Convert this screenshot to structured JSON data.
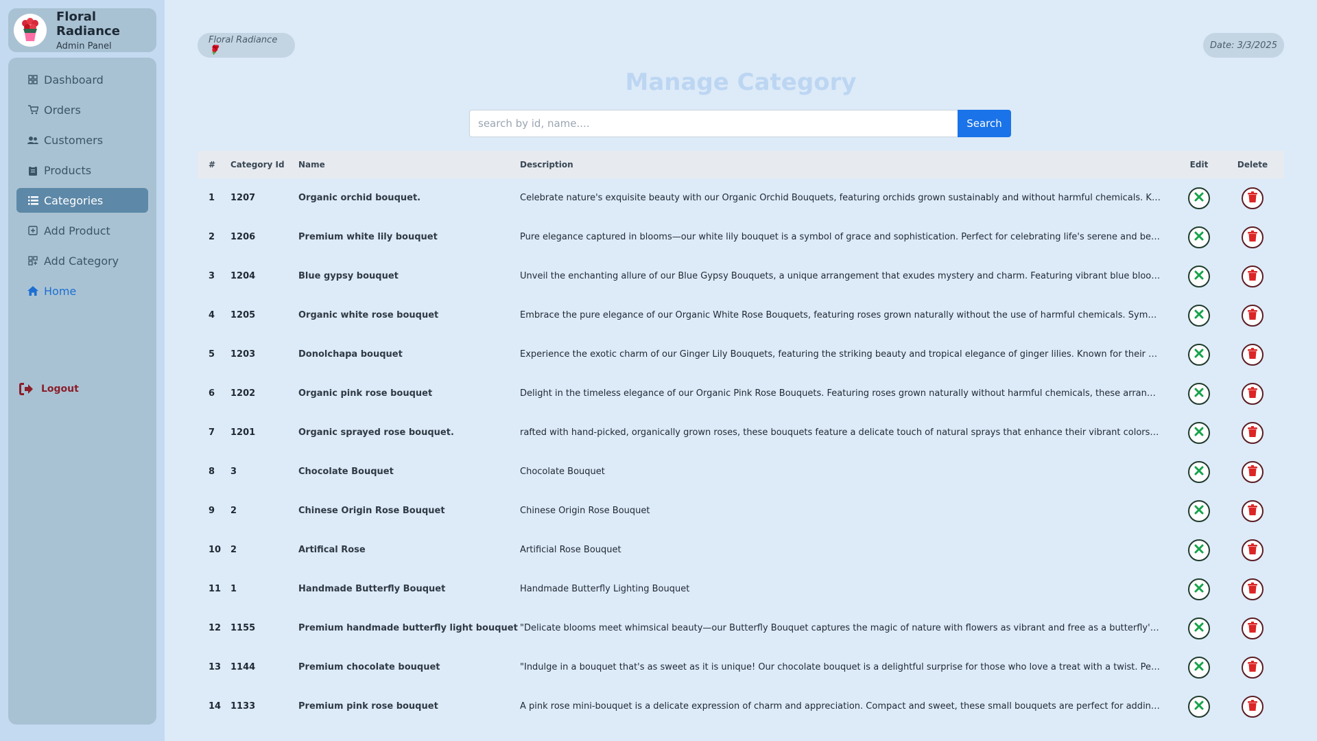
{
  "brand": {
    "name": "Floral Radiance",
    "subtitle": "Admin Panel"
  },
  "nav": {
    "items": [
      {
        "label": "Dashboard",
        "icon": "grid-icon"
      },
      {
        "label": "Orders",
        "icon": "cart-icon"
      },
      {
        "label": "Customers",
        "icon": "users-icon"
      },
      {
        "label": "Products",
        "icon": "clipboard-icon"
      },
      {
        "label": "Categories",
        "icon": "list-icon",
        "active": true
      },
      {
        "label": "Add Product",
        "icon": "plus-square-icon"
      },
      {
        "label": "Add Category",
        "icon": "grid-plus-icon"
      },
      {
        "label": "Home",
        "icon": "home-icon"
      }
    ],
    "logout_label": "Logout"
  },
  "header": {
    "brand_pill": "Floral Radiance 🌹",
    "date_pill": "Date: 3/3/2025",
    "title": "Manage Category"
  },
  "search": {
    "placeholder": "search by id, name....",
    "value": "",
    "button_label": "Search"
  },
  "table": {
    "headers": {
      "num": "#",
      "category_id": "Category Id",
      "name": "Name",
      "description": "Description",
      "edit": "Edit",
      "delete": "Delete"
    },
    "rows": [
      {
        "num": "1",
        "id": "1207",
        "name": "Organic orchid bouquet.",
        "description": "Celebrate nature's exquisite beauty with our Organic Orchid Bouquets, featuring orchids grown sustainably and without harmful chemicals. Known for ..."
      },
      {
        "num": "2",
        "id": "1206",
        "name": "Premium white lily bouquet",
        "description": "Pure elegance captured in blooms—our white lily bouquet is a symbol of grace and sophistication. Perfect for celebrating life's serene and beautifu..."
      },
      {
        "num": "3",
        "id": "1204",
        "name": "Blue gypsy bouquet",
        "description": "Unveil the enchanting allure of our Blue Gypsy Bouquets, a unique arrangement that exudes mystery and charm. Featuring vibrant blue blooms and deli..."
      },
      {
        "num": "4",
        "id": "1205",
        "name": "Organic white rose bouquet",
        "description": "Embrace the pure elegance of our Organic White Rose Bouquets, featuring roses grown naturally without the use of harmful chemicals. Symbolizing pur..."
      },
      {
        "num": "5",
        "id": "1203",
        "name": "Donolchapa bouquet",
        "description": "Experience the exotic charm of our Ginger Lily Bouquets, featuring the striking beauty and tropical elegance of ginger lilies. Known for their vibr..."
      },
      {
        "num": "6",
        "id": "1202",
        "name": "Organic pink rose bouquet",
        "description": "Delight in the timeless elegance of our Organic Pink Rose Bouquets. Featuring roses grown naturally without harmful chemicals, these arrangements c..."
      },
      {
        "num": "7",
        "id": "1201",
        "name": "Organic sprayed rose bouquet.",
        "description": "rafted with hand-picked, organically grown roses, these bouquets feature a delicate touch of natural sprays that enhance their vibrant colors and m..."
      },
      {
        "num": "8",
        "id": "3",
        "name": "Chocolate Bouquet",
        "description": "Chocolate Bouquet"
      },
      {
        "num": "9",
        "id": "2",
        "name": "Chinese Origin Rose Bouquet",
        "description": "Chinese Origin Rose Bouquet"
      },
      {
        "num": "10",
        "id": "2",
        "name": "Artifical Rose",
        "description": "Artificial Rose Bouquet"
      },
      {
        "num": "11",
        "id": "1",
        "name": "Handmade Butterfly Bouquet",
        "description": "Handmade Butterfly Lighting Bouquet"
      },
      {
        "num": "12",
        "id": "1155",
        "name": "Premium handmade butterfly light bouquet",
        "description": "\"Delicate blooms meet whimsical beauty—our Butterfly Bouquet captures the magic of nature with flowers as vibrant and free as a butterfly's wings. ..."
      },
      {
        "num": "13",
        "id": "1144",
        "name": "Premium chocolate bouquet",
        "description": "\"Indulge in a bouquet that's as sweet as it is unique! Our chocolate bouquet is a delightful surprise for those who love a treat with a twist. Perf..."
      },
      {
        "num": "14",
        "id": "1133",
        "name": "Premium pink rose bouquet",
        "description": "A pink rose mini-bouquet is a delicate expression of charm and appreciation. Compact and sweet, these small bouquets are perfect for adding a touch..."
      }
    ]
  },
  "colors": {
    "sidebar_bg": "#c4daf1",
    "panel_bg": "#a9c2d3",
    "active_nav": "#5d88a8",
    "accent": "#1a73e8",
    "edit_icon": "#16a34a",
    "delete_icon": "#dc2626",
    "logout": "#8a1e2a"
  }
}
